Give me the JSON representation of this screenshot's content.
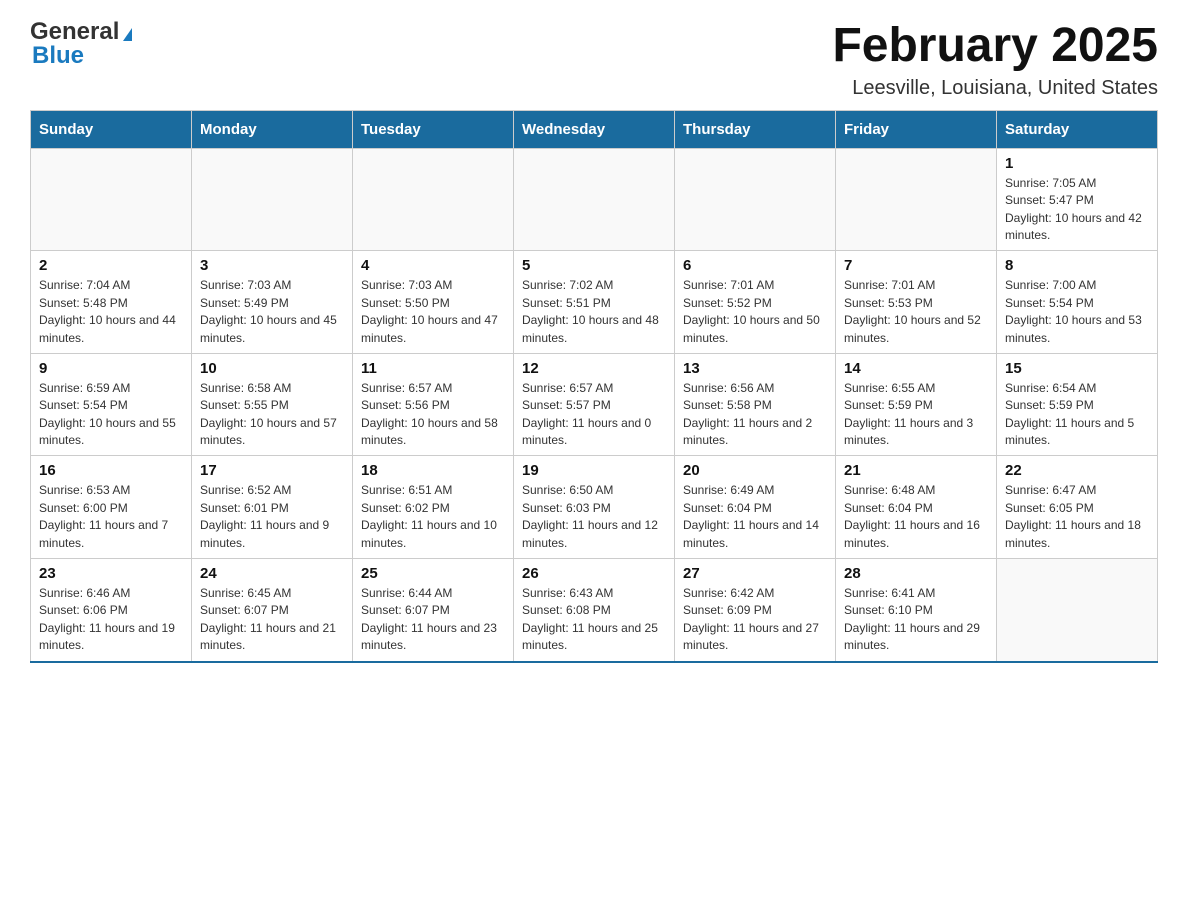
{
  "logo": {
    "general": "General",
    "blue": "Blue"
  },
  "title": "February 2025",
  "subtitle": "Leesville, Louisiana, United States",
  "weekdays": [
    "Sunday",
    "Monday",
    "Tuesday",
    "Wednesday",
    "Thursday",
    "Friday",
    "Saturday"
  ],
  "weeks": [
    [
      {
        "day": "",
        "sunrise": "",
        "sunset": "",
        "daylight": ""
      },
      {
        "day": "",
        "sunrise": "",
        "sunset": "",
        "daylight": ""
      },
      {
        "day": "",
        "sunrise": "",
        "sunset": "",
        "daylight": ""
      },
      {
        "day": "",
        "sunrise": "",
        "sunset": "",
        "daylight": ""
      },
      {
        "day": "",
        "sunrise": "",
        "sunset": "",
        "daylight": ""
      },
      {
        "day": "",
        "sunrise": "",
        "sunset": "",
        "daylight": ""
      },
      {
        "day": "1",
        "sunrise": "Sunrise: 7:05 AM",
        "sunset": "Sunset: 5:47 PM",
        "daylight": "Daylight: 10 hours and 42 minutes."
      }
    ],
    [
      {
        "day": "2",
        "sunrise": "Sunrise: 7:04 AM",
        "sunset": "Sunset: 5:48 PM",
        "daylight": "Daylight: 10 hours and 44 minutes."
      },
      {
        "day": "3",
        "sunrise": "Sunrise: 7:03 AM",
        "sunset": "Sunset: 5:49 PM",
        "daylight": "Daylight: 10 hours and 45 minutes."
      },
      {
        "day": "4",
        "sunrise": "Sunrise: 7:03 AM",
        "sunset": "Sunset: 5:50 PM",
        "daylight": "Daylight: 10 hours and 47 minutes."
      },
      {
        "day": "5",
        "sunrise": "Sunrise: 7:02 AM",
        "sunset": "Sunset: 5:51 PM",
        "daylight": "Daylight: 10 hours and 48 minutes."
      },
      {
        "day": "6",
        "sunrise": "Sunrise: 7:01 AM",
        "sunset": "Sunset: 5:52 PM",
        "daylight": "Daylight: 10 hours and 50 minutes."
      },
      {
        "day": "7",
        "sunrise": "Sunrise: 7:01 AM",
        "sunset": "Sunset: 5:53 PM",
        "daylight": "Daylight: 10 hours and 52 minutes."
      },
      {
        "day": "8",
        "sunrise": "Sunrise: 7:00 AM",
        "sunset": "Sunset: 5:54 PM",
        "daylight": "Daylight: 10 hours and 53 minutes."
      }
    ],
    [
      {
        "day": "9",
        "sunrise": "Sunrise: 6:59 AM",
        "sunset": "Sunset: 5:54 PM",
        "daylight": "Daylight: 10 hours and 55 minutes."
      },
      {
        "day": "10",
        "sunrise": "Sunrise: 6:58 AM",
        "sunset": "Sunset: 5:55 PM",
        "daylight": "Daylight: 10 hours and 57 minutes."
      },
      {
        "day": "11",
        "sunrise": "Sunrise: 6:57 AM",
        "sunset": "Sunset: 5:56 PM",
        "daylight": "Daylight: 10 hours and 58 minutes."
      },
      {
        "day": "12",
        "sunrise": "Sunrise: 6:57 AM",
        "sunset": "Sunset: 5:57 PM",
        "daylight": "Daylight: 11 hours and 0 minutes."
      },
      {
        "day": "13",
        "sunrise": "Sunrise: 6:56 AM",
        "sunset": "Sunset: 5:58 PM",
        "daylight": "Daylight: 11 hours and 2 minutes."
      },
      {
        "day": "14",
        "sunrise": "Sunrise: 6:55 AM",
        "sunset": "Sunset: 5:59 PM",
        "daylight": "Daylight: 11 hours and 3 minutes."
      },
      {
        "day": "15",
        "sunrise": "Sunrise: 6:54 AM",
        "sunset": "Sunset: 5:59 PM",
        "daylight": "Daylight: 11 hours and 5 minutes."
      }
    ],
    [
      {
        "day": "16",
        "sunrise": "Sunrise: 6:53 AM",
        "sunset": "Sunset: 6:00 PM",
        "daylight": "Daylight: 11 hours and 7 minutes."
      },
      {
        "day": "17",
        "sunrise": "Sunrise: 6:52 AM",
        "sunset": "Sunset: 6:01 PM",
        "daylight": "Daylight: 11 hours and 9 minutes."
      },
      {
        "day": "18",
        "sunrise": "Sunrise: 6:51 AM",
        "sunset": "Sunset: 6:02 PM",
        "daylight": "Daylight: 11 hours and 10 minutes."
      },
      {
        "day": "19",
        "sunrise": "Sunrise: 6:50 AM",
        "sunset": "Sunset: 6:03 PM",
        "daylight": "Daylight: 11 hours and 12 minutes."
      },
      {
        "day": "20",
        "sunrise": "Sunrise: 6:49 AM",
        "sunset": "Sunset: 6:04 PM",
        "daylight": "Daylight: 11 hours and 14 minutes."
      },
      {
        "day": "21",
        "sunrise": "Sunrise: 6:48 AM",
        "sunset": "Sunset: 6:04 PM",
        "daylight": "Daylight: 11 hours and 16 minutes."
      },
      {
        "day": "22",
        "sunrise": "Sunrise: 6:47 AM",
        "sunset": "Sunset: 6:05 PM",
        "daylight": "Daylight: 11 hours and 18 minutes."
      }
    ],
    [
      {
        "day": "23",
        "sunrise": "Sunrise: 6:46 AM",
        "sunset": "Sunset: 6:06 PM",
        "daylight": "Daylight: 11 hours and 19 minutes."
      },
      {
        "day": "24",
        "sunrise": "Sunrise: 6:45 AM",
        "sunset": "Sunset: 6:07 PM",
        "daylight": "Daylight: 11 hours and 21 minutes."
      },
      {
        "day": "25",
        "sunrise": "Sunrise: 6:44 AM",
        "sunset": "Sunset: 6:07 PM",
        "daylight": "Daylight: 11 hours and 23 minutes."
      },
      {
        "day": "26",
        "sunrise": "Sunrise: 6:43 AM",
        "sunset": "Sunset: 6:08 PM",
        "daylight": "Daylight: 11 hours and 25 minutes."
      },
      {
        "day": "27",
        "sunrise": "Sunrise: 6:42 AM",
        "sunset": "Sunset: 6:09 PM",
        "daylight": "Daylight: 11 hours and 27 minutes."
      },
      {
        "day": "28",
        "sunrise": "Sunrise: 6:41 AM",
        "sunset": "Sunset: 6:10 PM",
        "daylight": "Daylight: 11 hours and 29 minutes."
      },
      {
        "day": "",
        "sunrise": "",
        "sunset": "",
        "daylight": ""
      }
    ]
  ]
}
